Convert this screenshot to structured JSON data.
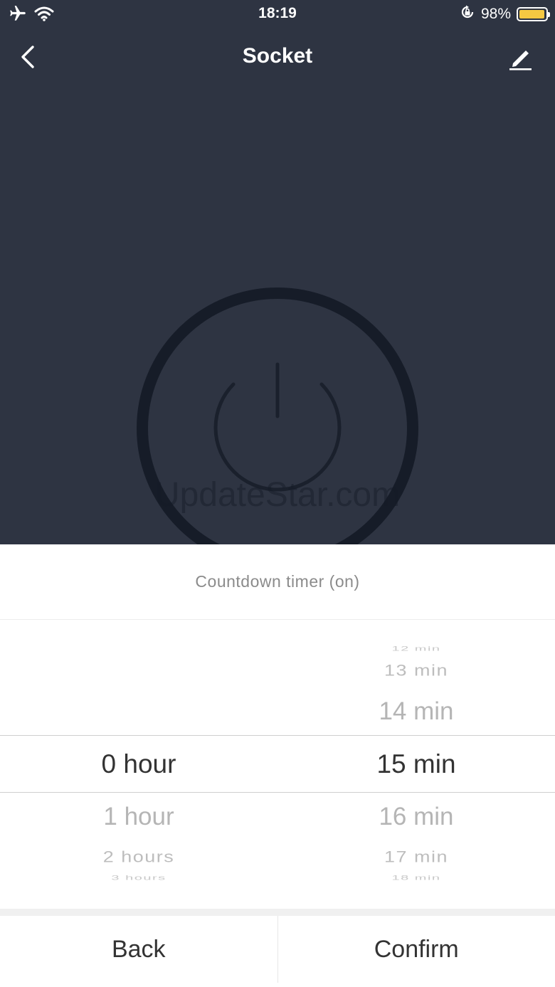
{
  "status_bar": {
    "time": "18:19",
    "battery_percent": "98%",
    "battery_level": 0.98,
    "icons": [
      "airplane-icon",
      "wifi-icon",
      "orientation-lock-icon",
      "battery-icon"
    ]
  },
  "nav": {
    "title": "Socket",
    "left_icon": "chevron-left-icon",
    "right_icon": "edit-pencil-icon"
  },
  "device": {
    "icon": "power-icon",
    "watermark": "UpdateStar.com"
  },
  "timer_sheet": {
    "title": "Countdown timer (on)",
    "hours": {
      "items": [
        "0 hour",
        "1 hour",
        "2 hours",
        "3 hours"
      ],
      "selected": "0 hour"
    },
    "minutes": {
      "items": [
        "12 min",
        "13 min",
        "14 min",
        "15 min",
        "16 min",
        "17 min",
        "18 min"
      ],
      "selected": "15 min"
    },
    "back_label": "Back",
    "confirm_label": "Confirm"
  },
  "colors": {
    "background": "#2e3442",
    "ring": "#161c28",
    "battery": "#f5c842",
    "text_selected": "#333333",
    "text_faded": "#b5b5b5"
  }
}
